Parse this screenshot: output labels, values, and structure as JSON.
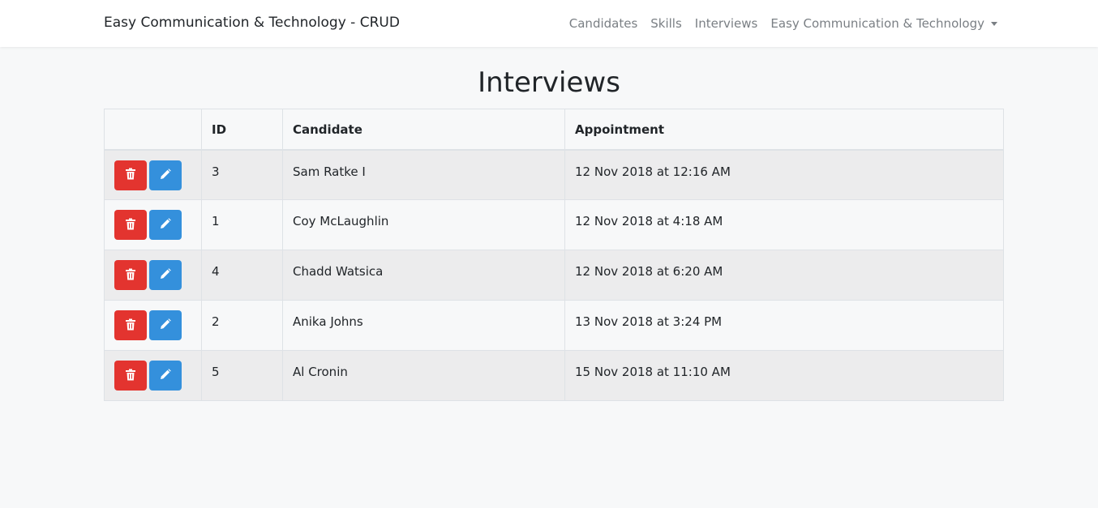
{
  "navbar": {
    "brand": "Easy Communication & Technology - CRUD",
    "links": [
      "Candidates",
      "Skills",
      "Interviews",
      "Easy Communication & Technology"
    ]
  },
  "page": {
    "title": "Interviews"
  },
  "table": {
    "headers": [
      "",
      "ID",
      "Candidate",
      "Appointment"
    ],
    "rows": [
      {
        "id": "3",
        "candidate": "Sam Ratke I",
        "appointment": "12 Nov 2018 at 12:16 AM"
      },
      {
        "id": "1",
        "candidate": "Coy McLaughlin",
        "appointment": "12 Nov 2018 at 4:18 AM"
      },
      {
        "id": "4",
        "candidate": "Chadd Watsica",
        "appointment": "12 Nov 2018 at 6:20 AM"
      },
      {
        "id": "2",
        "candidate": "Anika Johns",
        "appointment": "13 Nov 2018 at 3:24 PM"
      },
      {
        "id": "5",
        "candidate": "Al Cronin",
        "appointment": "15 Nov 2018 at 11:10 AM"
      }
    ]
  },
  "icons": {
    "delete": "trash-icon",
    "edit": "pencil-icon"
  },
  "colors": {
    "delete": "#e3342f",
    "edit": "#3490dc"
  }
}
